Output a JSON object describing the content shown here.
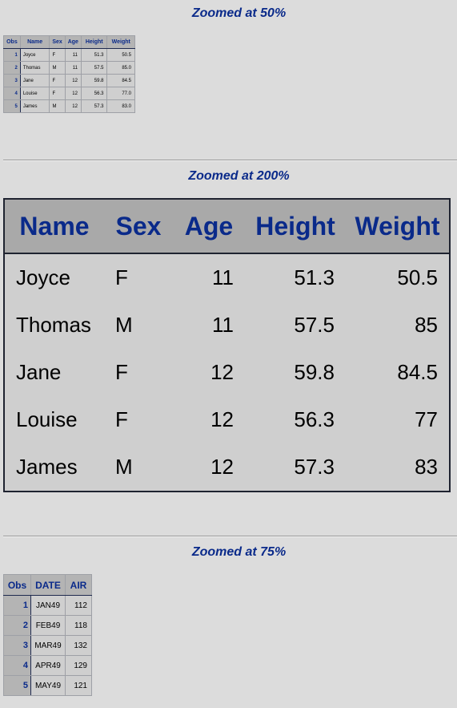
{
  "colors": {
    "background": "#dcdcdc",
    "title": "#0a2a8a",
    "header_bg": "#b4b4b4",
    "cell_bg": "#cfcfcf",
    "border": "#1f2a4f"
  },
  "sections": [
    {
      "title": "Zoomed at 50%",
      "table": {
        "headers": [
          "Obs",
          "Name",
          "Sex",
          "Age",
          "Height",
          "Weight"
        ],
        "rows": [
          [
            "1",
            "Joyce",
            "F",
            "11",
            "51.3",
            "50.5"
          ],
          [
            "2",
            "Thomas",
            "M",
            "11",
            "57.5",
            "85.0"
          ],
          [
            "3",
            "Jane",
            "F",
            "12",
            "59.8",
            "84.5"
          ],
          [
            "4",
            "Louise",
            "F",
            "12",
            "56.3",
            "77.0"
          ],
          [
            "5",
            "James",
            "M",
            "12",
            "57.3",
            "83.0"
          ]
        ]
      }
    },
    {
      "title": "Zoomed at 200%",
      "table": {
        "headers": [
          "Name",
          "Sex",
          "Age",
          "Height",
          "Weight"
        ],
        "rows": [
          [
            "Joyce",
            "F",
            "11",
            "51.3",
            "50.5"
          ],
          [
            "Thomas",
            "M",
            "11",
            "57.5",
            "85"
          ],
          [
            "Jane",
            "F",
            "12",
            "59.8",
            "84.5"
          ],
          [
            "Louise",
            "F",
            "12",
            "56.3",
            "77"
          ],
          [
            "James",
            "M",
            "12",
            "57.3",
            "83"
          ]
        ]
      }
    },
    {
      "title": "Zoomed at 75%",
      "table": {
        "headers": [
          "Obs",
          "DATE",
          "AIR"
        ],
        "rows": [
          [
            "1",
            "JAN49",
            "112"
          ],
          [
            "2",
            "FEB49",
            "118"
          ],
          [
            "3",
            "MAR49",
            "132"
          ],
          [
            "4",
            "APR49",
            "129"
          ],
          [
            "5",
            "MAY49",
            "121"
          ]
        ]
      }
    }
  ]
}
